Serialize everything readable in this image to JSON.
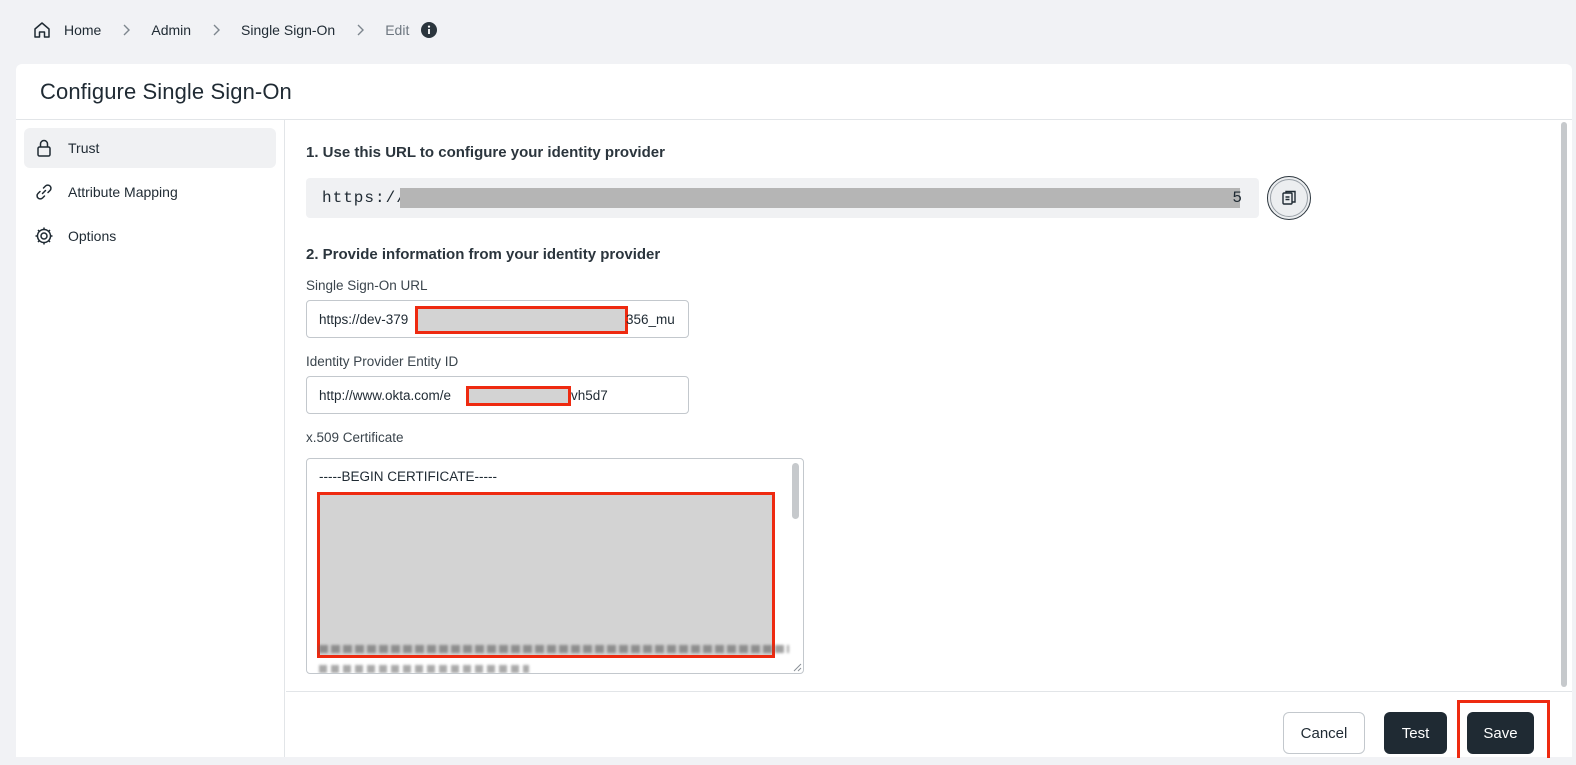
{
  "breadcrumb": {
    "home": "Home",
    "admin": "Admin",
    "sso": "Single Sign-On",
    "current": "Edit"
  },
  "page": {
    "title": "Configure Single Sign-On"
  },
  "sidebar": {
    "items": [
      {
        "label": "Trust",
        "icon": "lock-icon",
        "active": true
      },
      {
        "label": "Attribute Mapping",
        "icon": "link-icon",
        "active": false
      },
      {
        "label": "Options",
        "icon": "gear-icon",
        "active": false
      }
    ]
  },
  "step1": {
    "title": "1. Use this URL to configure your identity provider",
    "url_prefix": "https://",
    "url_suffix": "5"
  },
  "step2": {
    "title": "2. Provide information from your identity provider",
    "sso_url": {
      "label": "Single Sign-On URL",
      "value_start": "https://dev-379",
      "value_end": "356_mu"
    },
    "entity_id": {
      "label": "Identity Provider Entity ID",
      "value_start": "http://www.okta.com/e",
      "value_end": "vh5d7"
    },
    "certificate": {
      "label": "x.509 Certificate",
      "first_line": "-----BEGIN CERTIFICATE-----"
    }
  },
  "footer": {
    "cancel_label": "Cancel",
    "test_label": "Test",
    "save_label": "Save"
  },
  "colors": {
    "primary_button": "#1f2a33",
    "highlight": "#ee2a10",
    "redaction": "#d3d3d3"
  }
}
